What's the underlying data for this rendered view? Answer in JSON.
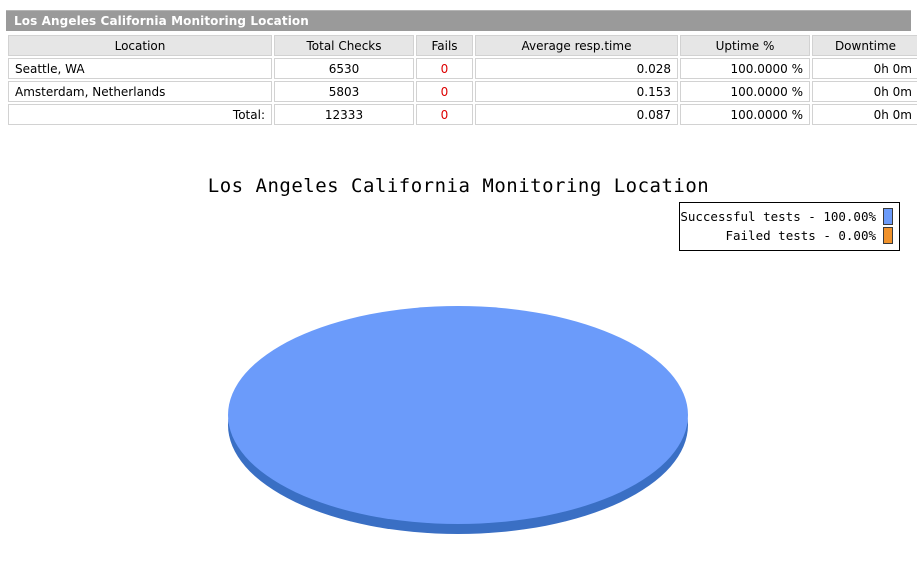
{
  "header": {
    "title": "Los Angeles California Monitoring Location"
  },
  "table": {
    "columns": [
      "Location",
      "Total Checks",
      "Fails",
      "Average resp.time",
      "Uptime %",
      "Downtime"
    ],
    "rows": [
      {
        "location": "Seattle, WA",
        "total_checks": "6530",
        "fails": "0",
        "avg_resp_time": "0.028",
        "uptime": "100.0000 %",
        "downtime": "0h 0m"
      },
      {
        "location": "Amsterdam, Netherlands",
        "total_checks": "5803",
        "fails": "0",
        "avg_resp_time": "0.153",
        "uptime": "100.0000 %",
        "downtime": "0h 0m"
      }
    ],
    "total_row": {
      "location": "Total:",
      "total_checks": "12333",
      "fails": "0",
      "avg_resp_time": "0.087",
      "uptime": "100.0000 %",
      "downtime": "0h 0m"
    }
  },
  "chart_data": {
    "type": "pie",
    "title": "Los Angeles California Monitoring Location",
    "categories": [
      "Successful tests",
      "Failed tests"
    ],
    "values": [
      100.0,
      0.0
    ],
    "value_suffix": "%",
    "colors": [
      "#6b9bfa",
      "#f0922b"
    ],
    "legend": {
      "position": "top-right",
      "entries": [
        {
          "label": "Successful tests - 100.00%",
          "color": "#6b9bfa"
        },
        {
          "label": "Failed tests - 0.00%",
          "color": "#f0922b"
        }
      ]
    },
    "grid": false,
    "three_d": true
  },
  "colors": {
    "header_bar": "#9a9a9a",
    "table_header": "#e6e6e6",
    "fails_text": "#dd0000",
    "pie_top": "#6b9bfa",
    "pie_side": "#3a6fc4",
    "legend_success": "#6b9bfa",
    "legend_failed": "#f0922b"
  }
}
